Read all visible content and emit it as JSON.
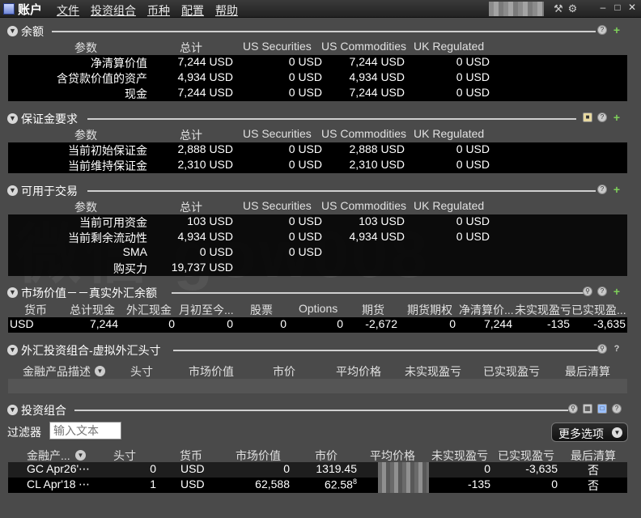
{
  "app": {
    "title": "账户",
    "menu": [
      "文件",
      "投资组合",
      "币种",
      "配置",
      "帮助"
    ]
  },
  "balance": {
    "title": "余额",
    "headers": [
      "参数",
      "总计",
      "US Securities",
      "US Commodities",
      "UK Regulated"
    ],
    "rows": [
      [
        "净清算价值",
        "7,244 USD",
        "0 USD",
        "7,244 USD",
        "0 USD"
      ],
      [
        "含贷款价值的资产",
        "4,934 USD",
        "0 USD",
        "4,934 USD",
        "0 USD"
      ],
      [
        "现金",
        "7,244 USD",
        "0 USD",
        "7,244 USD",
        "0 USD"
      ]
    ]
  },
  "margin": {
    "title": "保证金要求",
    "headers": [
      "参数",
      "总计",
      "US Securities",
      "US Commodities",
      "UK Regulated"
    ],
    "rows": [
      [
        "当前初始保证金",
        "2,888 USD",
        "0 USD",
        "2,888 USD",
        "0 USD"
      ],
      [
        "当前维持保证金",
        "2,310 USD",
        "0 USD",
        "2,310 USD",
        "0 USD"
      ]
    ]
  },
  "available": {
    "title": "可用于交易",
    "headers": [
      "参数",
      "总计",
      "US Securities",
      "US Commodities",
      "UK Regulated"
    ],
    "rows": [
      [
        "当前可用资金",
        "103 USD",
        "0 USD",
        "103 USD",
        "0 USD"
      ],
      [
        "当前剩余流动性",
        "4,934 USD",
        "0 USD",
        "4,934 USD",
        "0 USD"
      ],
      [
        "SMA",
        "0 USD",
        "0 USD",
        "",
        ""
      ],
      [
        "购买力",
        "19,737 USD",
        "",
        "",
        ""
      ]
    ]
  },
  "watermark": "微信 gow008",
  "market": {
    "title": "市场价值－－真实外汇余额",
    "headers": [
      "货币",
      "总计现金",
      "外汇现金",
      "月初至今...",
      "股票",
      "Options",
      "期货",
      "期货期权",
      "净清算价...",
      "未实现盈亏",
      "已实现盈..."
    ],
    "row": [
      "USD",
      "7,244",
      "0",
      "0",
      "0",
      "0",
      "-2,672",
      "0",
      "7,244",
      "-135",
      "-3,635"
    ]
  },
  "fx": {
    "title": "外汇投资组合-虚拟外汇头寸",
    "headers": [
      "金融产品描述",
      "头寸",
      "市场价值",
      "市价",
      "平均价格",
      "未实现盈亏",
      "已实现盈亏",
      "最后清算"
    ]
  },
  "portfolio": {
    "title": "投资组合",
    "filter_label": "过滤器",
    "filter_placeholder": "输入文本",
    "more_button": "更多选项",
    "headers": [
      "金融产...",
      "头寸",
      "货币",
      "市场价值",
      "市价",
      "平均价格",
      "未实现盈亏",
      "已实现盈亏",
      "最后清算"
    ],
    "rows": [
      {
        "name": "GC Apr26'",
        "position": "0",
        "currency": "USD",
        "market_value": "0",
        "price": "1319.45",
        "unrealized": "0",
        "realized": "-3,635",
        "last": "否"
      },
      {
        "name": "CL Apr'18",
        "position": "1",
        "currency": "USD",
        "market_value": "62,588",
        "price": "62.58",
        "price_sup": "8",
        "unrealized": "-135",
        "realized": "0",
        "last": "否"
      }
    ]
  },
  "colors": {
    "background": "#4a4a4a",
    "data_row": "#000000",
    "plus_icon": "#7ed05a"
  }
}
